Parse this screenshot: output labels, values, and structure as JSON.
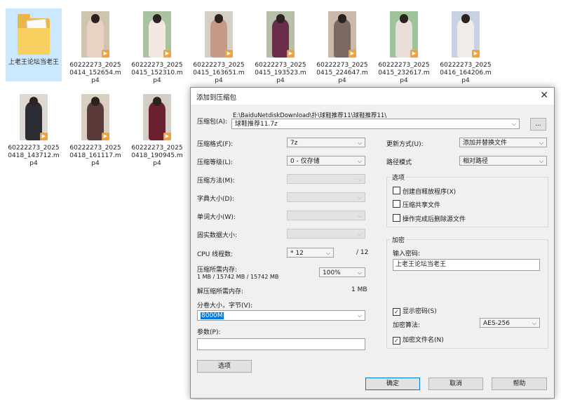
{
  "files": [
    {
      "name": "上老王论坛当老王",
      "type": "folder",
      "selected": true
    },
    {
      "name": "60222273_20250414_152654.mp4",
      "type": "video",
      "bg": "#cfc4b0",
      "fig": "#e7d2c4"
    },
    {
      "name": "60222273_20250415_152310.mp4",
      "type": "video",
      "bg": "#a9c3a0",
      "fig": "#f2e8e0"
    },
    {
      "name": "60222273_20250415_163651.mp4",
      "type": "video",
      "bg": "#d6cfc8",
      "fig": "#c69a86"
    },
    {
      "name": "60222273_20250415_193523.mp4",
      "type": "video",
      "bg": "#b8bfa8",
      "fig": "#6a2e4a"
    },
    {
      "name": "60222273_20250415_224647.mp4",
      "type": "video",
      "bg": "#cbb8a8",
      "fig": "#7b6a62"
    },
    {
      "name": "60222273_20250415_232617.mp4",
      "type": "video",
      "bg": "#9fc39a",
      "fig": "#e9dfd8"
    },
    {
      "name": "60222273_20250416_164206.mp4",
      "type": "video",
      "bg": "#c9d2e4",
      "fig": "#f0ece8"
    },
    {
      "name": "60222273_20250418_143712.mp4",
      "type": "video",
      "bg": "#ded8d2",
      "fig": "#2c2c33"
    },
    {
      "name": "60222273_20250418_161117.mp4",
      "type": "video",
      "bg": "#d9cfc3",
      "fig": "#5b3a3a"
    },
    {
      "name": "60222273_20250418_190945.mp4",
      "type": "video",
      "bg": "#d5cec6",
      "fig": "#6b1f2f"
    }
  ],
  "dialog": {
    "title": "添加到压缩包",
    "archive_label": "压缩包(A):",
    "archive_path": "E:\\BaiduNetdiskDownload\\扑\\球鞋推荐11\\球鞋推荐11\\",
    "archive_name": "球鞋推荐11.7z",
    "browse": "...",
    "format_label": "压缩格式(F):",
    "format_value": "7z",
    "level_label": "压缩等级(L):",
    "level_value": "0 - 仅存储",
    "method_label": "压缩方法(M):",
    "dict_label": "字典大小(D):",
    "word_label": "单词大小(W):",
    "solid_label": "固实数据大小:",
    "threads_label": "CPU 线程数:",
    "threads_value": "* 12",
    "threads_max": "/ 12",
    "mem_comp_label": "压缩所需内存:",
    "mem_comp_value": "1 MB / 15742 MB / 15742 MB",
    "mem_percent": "100%",
    "mem_decomp_label": "解压缩所需内存:",
    "mem_decomp_value": "1 MB",
    "split_label": "分卷大小，字节(V):",
    "split_value": "8000M",
    "params_label": "参数(P):",
    "params_value": "",
    "options_btn": "选项",
    "update_label": "更新方式(U):",
    "update_value": "添加并替换文件",
    "path_label": "路径模式",
    "path_value": "相对路径",
    "options_group": "选项",
    "opt_sfx": "创建自释放程序(X)",
    "opt_shared": "压缩共享文件",
    "opt_delete": "操作完成后删除源文件",
    "encrypt_group": "加密",
    "password_label": "输入密码:",
    "password_value": "上老王论坛当老王",
    "show_password": "显示密码(S)",
    "enc_method_label": "加密算法:",
    "enc_method_value": "AES-256",
    "enc_names": "加密文件名(N)",
    "ok": "确定",
    "cancel": "取消",
    "help": "帮助"
  }
}
